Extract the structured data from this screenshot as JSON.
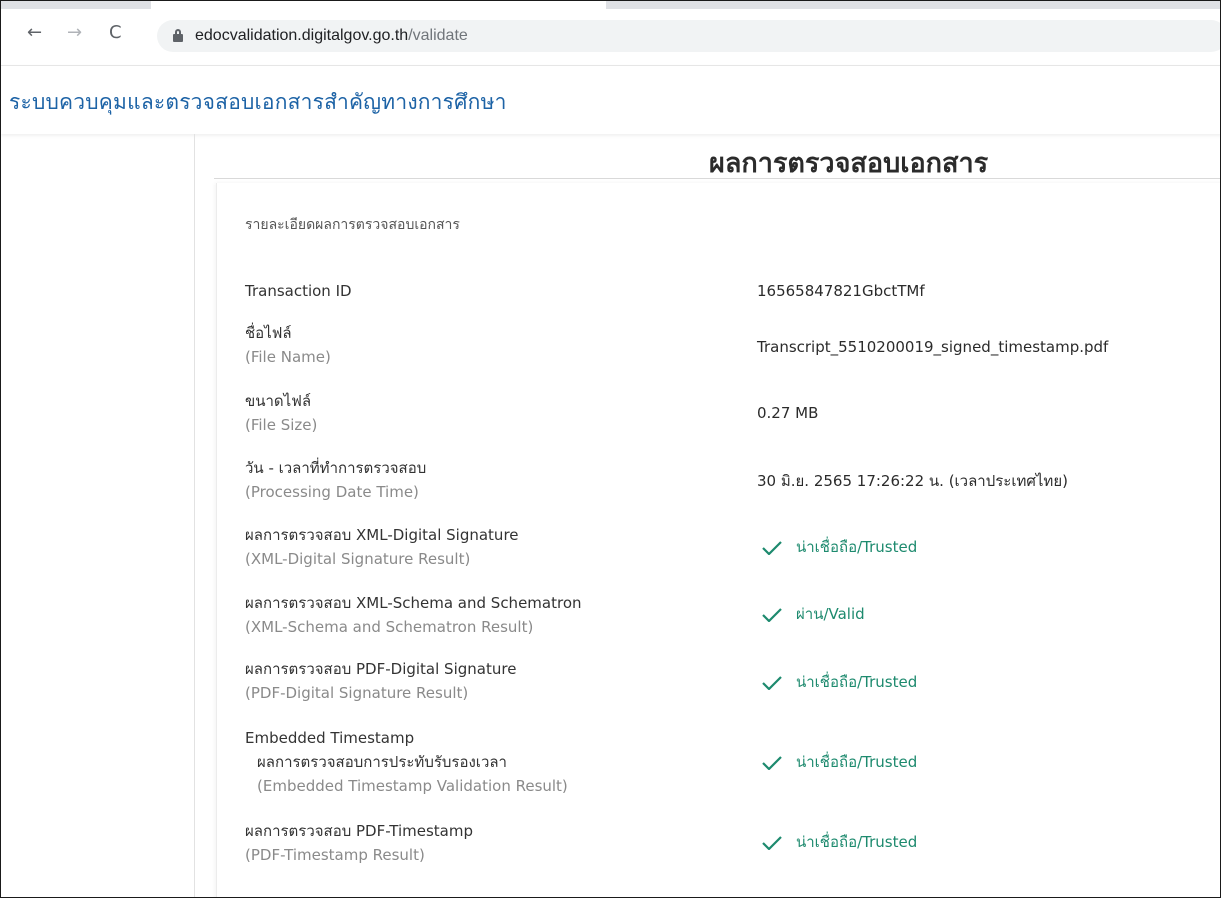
{
  "browser": {
    "url_host": "edocvalidation.digitalgov.go.th",
    "url_path": "/validate",
    "back_icon": "←",
    "forward_icon": "→",
    "reload_icon": "C"
  },
  "site": {
    "title": "ระบบควบคุมและตรวจสอบเอกสารสำคัญทางการศึกษา"
  },
  "page": {
    "heading": "ผลการตรวจสอบเอกสาร",
    "card_title": "รายละเอียดผลการตรวจสอบเอกสาร"
  },
  "details": {
    "transaction_label": "Transaction ID",
    "transaction_value": "16565847821GbctTMf",
    "file_name_label": "ชื่อไฟล์",
    "file_name_sub": "(File Name)",
    "file_name_value": "Transcript_5510200019_signed_timestamp.pdf",
    "file_size_label": "ขนาดไฟล์",
    "file_size_sub": "(File Size)",
    "file_size_value": "0.27 MB",
    "datetime_label": "วัน - เวลาที่ทำการตรวจสอบ",
    "datetime_sub": "(Processing Date Time)",
    "datetime_value": "30 มิ.ย. 2565 17:26:22 น. (เวลาประเทศไทย)"
  },
  "results": {
    "xml_sig_label": "ผลการตรวจสอบ XML-Digital Signature",
    "xml_sig_sub": "(XML-Digital Signature Result)",
    "xml_sig_value": "น่าเชื่อถือ/Trusted",
    "xml_schema_label": "ผลการตรวจสอบ XML-Schema and Schematron",
    "xml_schema_sub": "(XML-Schema and Schematron Result)",
    "xml_schema_value": "ผ่าน/Valid",
    "pdf_sig_label": "ผลการตรวจสอบ PDF-Digital Signature",
    "pdf_sig_sub": "(PDF-Digital Signature Result)",
    "pdf_sig_value": "น่าเชื่อถือ/Trusted",
    "embedded_label": "Embedded Timestamp",
    "embedded_label_th": "ผลการตรวจสอบการประทับรับรองเวลา",
    "embedded_sub": "(Embedded Timestamp Validation Result)",
    "embedded_value": "น่าเชื่อถือ/Trusted",
    "pdf_ts_label": "ผลการตรวจสอบ PDF-Timestamp",
    "pdf_ts_sub": "(PDF-Timestamp Result)",
    "pdf_ts_value": "น่าเชื่อถือ/Trusted"
  },
  "colors": {
    "brand_blue": "#1d63a6",
    "status_green": "#1d8a6e"
  },
  "icons": {
    "lock": "lock-icon",
    "check": "check-icon"
  }
}
